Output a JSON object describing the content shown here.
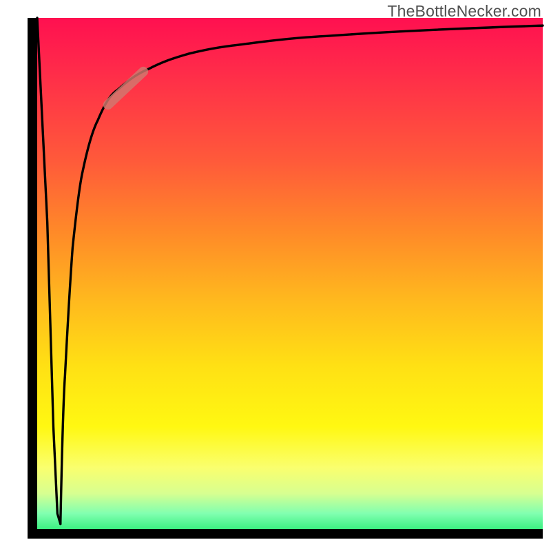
{
  "attribution": "TheBottleNecker.com",
  "colors": {
    "axis": "#000000",
    "marker": "#d07a70",
    "gradient_top": "#ff1050",
    "gradient_bottom": "#3cf082"
  },
  "chart_data": {
    "type": "line",
    "title": "",
    "xlabel": "",
    "ylabel": "",
    "xlim": [
      0,
      100
    ],
    "ylim": [
      0,
      100
    ],
    "grid": false,
    "legend": false,
    "annotations": [
      "TheBottleNecker.com"
    ],
    "series": [
      {
        "name": "spike-down",
        "x": [
          0.0,
          2.0,
          3.2,
          4.0,
          4.6
        ],
        "values": [
          100,
          60,
          20,
          3,
          1
        ]
      },
      {
        "name": "main-curve",
        "x": [
          4.6,
          5.5,
          7.0,
          9.0,
          12.0,
          16.0,
          22.0,
          30.0,
          42.0,
          58.0,
          75.0,
          100.0
        ],
        "values": [
          1,
          30,
          55,
          70,
          80,
          86,
          90,
          93,
          95,
          96.5,
          97.5,
          98.5
        ]
      }
    ],
    "marker": {
      "on_series": "main-curve",
      "x_range": [
        14.0,
        21.0
      ],
      "note": "highlighted segment of curve"
    }
  }
}
